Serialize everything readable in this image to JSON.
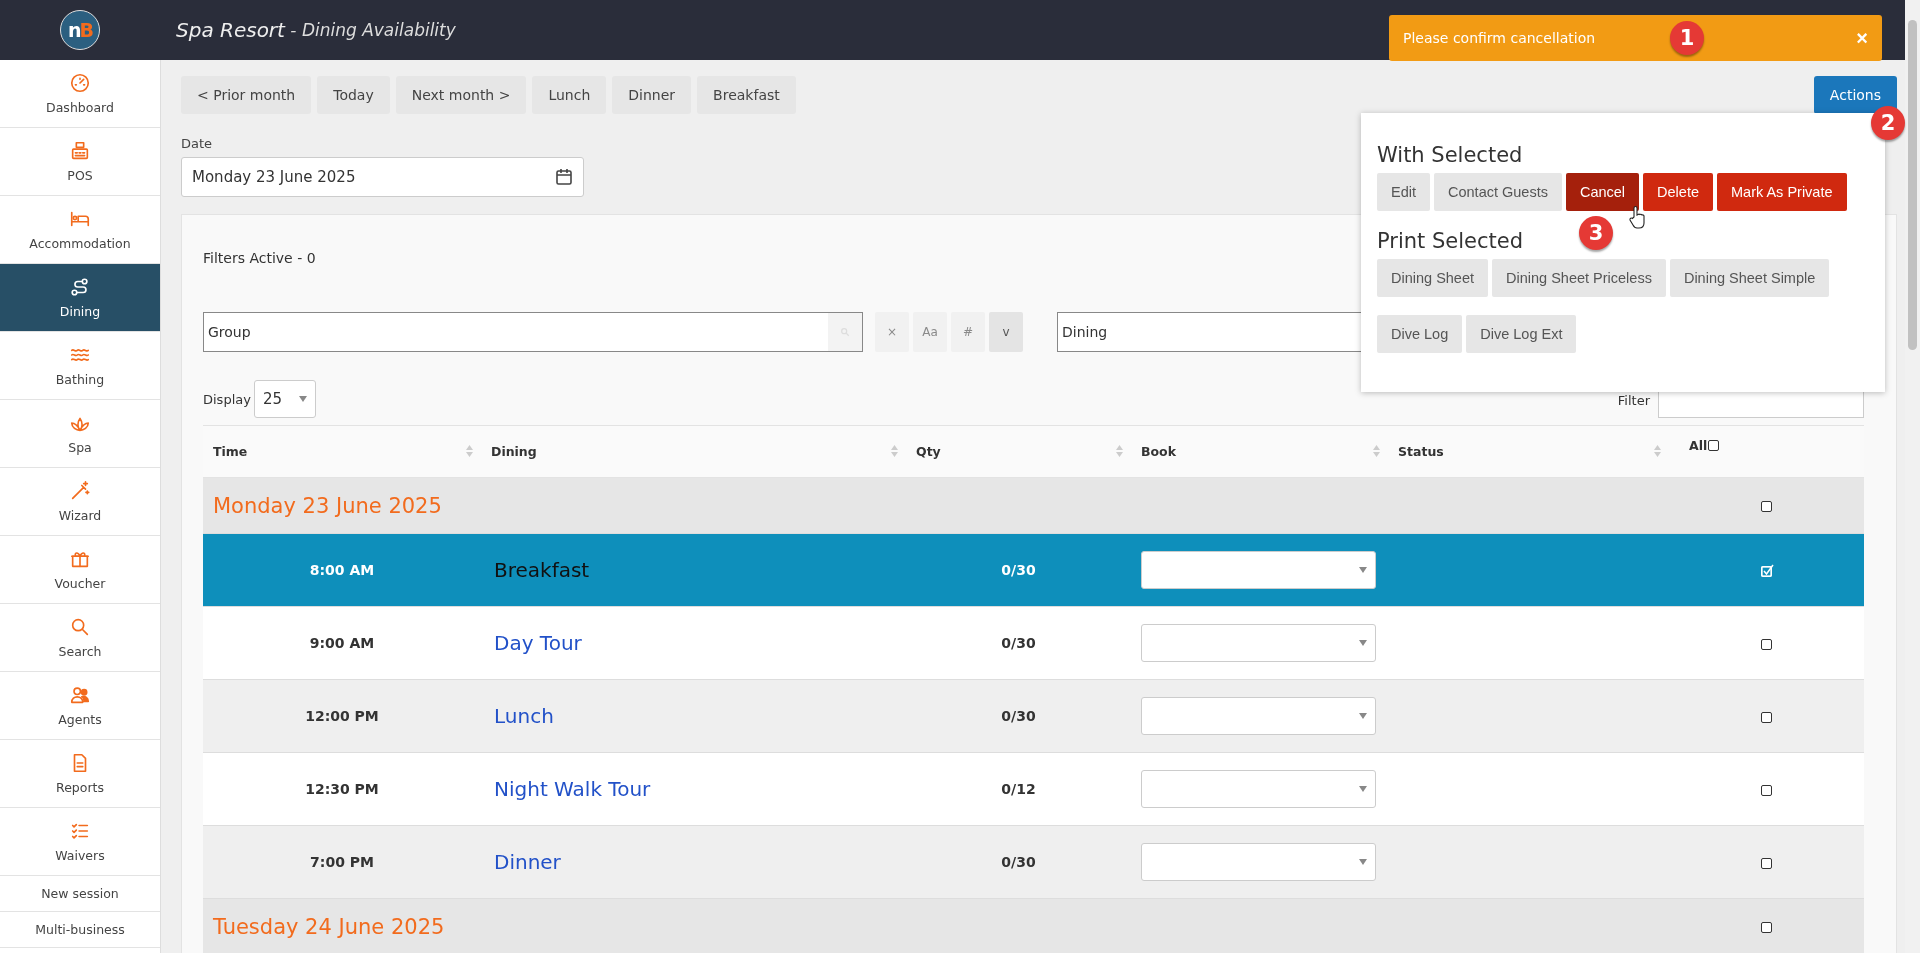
{
  "header": {
    "logo": {
      "first": "n",
      "second": "B"
    },
    "title": "Spa Resort",
    "subtitle": " - Dining Availability"
  },
  "toast": {
    "message": "Please confirm cancellation",
    "close": "×"
  },
  "sidebar": {
    "items": [
      {
        "label": "Dashboard",
        "kind": "nav",
        "selected": false
      },
      {
        "label": "POS",
        "kind": "nav",
        "selected": false
      },
      {
        "label": "Accommodation",
        "kind": "nav",
        "selected": false
      },
      {
        "label": "Dining",
        "kind": "nav",
        "selected": true
      },
      {
        "label": "Bathing",
        "kind": "nav",
        "selected": false
      },
      {
        "label": "Spa",
        "kind": "nav",
        "selected": false
      },
      {
        "label": "Wizard",
        "kind": "nav",
        "selected": false
      },
      {
        "label": "Voucher",
        "kind": "nav",
        "selected": false
      },
      {
        "label": "Search",
        "kind": "nav",
        "selected": false
      },
      {
        "label": "Agents",
        "kind": "nav",
        "selected": false
      },
      {
        "label": "Reports",
        "kind": "nav",
        "selected": false
      },
      {
        "label": "Waivers",
        "kind": "nav",
        "selected": false
      },
      {
        "label": "New session",
        "kind": "text",
        "selected": false
      },
      {
        "label": "Multi-business",
        "kind": "text",
        "selected": false
      }
    ]
  },
  "toolbar": {
    "buttons": [
      "< Prior month",
      "Today",
      "Next month >",
      "Lunch",
      "Dinner",
      "Breakfast"
    ],
    "actions": "Actions"
  },
  "date_field": {
    "label": "Date",
    "value": "Monday 23 June 2025"
  },
  "filters": {
    "title": "Filters Active - 0",
    "group_field": {
      "value": "Group"
    },
    "group_buttons": [
      "×",
      "Aa",
      "#",
      "v"
    ],
    "dining_field": {
      "value": "Dining"
    },
    "display_label": "Display",
    "display_value": "25",
    "filter_label": "Filter"
  },
  "table": {
    "columns": [
      "Time",
      "Dining",
      "Qty",
      "Book",
      "Status",
      "All"
    ],
    "all_checked": false,
    "rows": [
      {
        "kind": "date",
        "label": "Monday 23 June 2025",
        "checked": false
      },
      {
        "kind": "slot",
        "time": "8:00 AM",
        "name": "Breakfast",
        "qty": "0/30",
        "selected": true,
        "checked": true
      },
      {
        "kind": "slot",
        "time": "9:00 AM",
        "name": "Day Tour",
        "qty": "0/30",
        "selected": false,
        "checked": false
      },
      {
        "kind": "slot",
        "time": "12:00 PM",
        "name": "Lunch",
        "qty": "0/30",
        "selected": false,
        "checked": false
      },
      {
        "kind": "slot",
        "time": "12:30 PM",
        "name": "Night Walk Tour",
        "qty": "0/12",
        "selected": false,
        "checked": false
      },
      {
        "kind": "slot",
        "time": "7:00 PM",
        "name": "Dinner",
        "qty": "0/30",
        "selected": false,
        "checked": false
      },
      {
        "kind": "date",
        "label": "Tuesday 24 June 2025",
        "checked": false
      }
    ]
  },
  "actions_menu": {
    "sections": [
      {
        "title": "With Selected",
        "buttons": [
          {
            "label": "Edit",
            "kind": "plain",
            "selected": false
          },
          {
            "label": "Contact Guests",
            "kind": "plain",
            "selected": false
          },
          {
            "label": "Cancel",
            "kind": "danger",
            "selected": true
          },
          {
            "label": "Delete",
            "kind": "danger",
            "selected": false
          },
          {
            "label": "Mark As Private",
            "kind": "danger",
            "selected": false
          }
        ]
      },
      {
        "title": "Print Selected",
        "buttons": [
          {
            "label": "Dining Sheet",
            "kind": "plain",
            "selected": false
          },
          {
            "label": "Dining Sheet Priceless",
            "kind": "plain",
            "selected": false
          },
          {
            "label": "Dining Sheet Simple",
            "kind": "plain",
            "selected": false
          },
          {
            "label": "Dive Log",
            "kind": "plain",
            "selected": false
          },
          {
            "label": "Dive Log Ext",
            "kind": "plain",
            "selected": false
          }
        ]
      }
    ]
  },
  "step_badges": [
    "1",
    "2",
    "3"
  ]
}
